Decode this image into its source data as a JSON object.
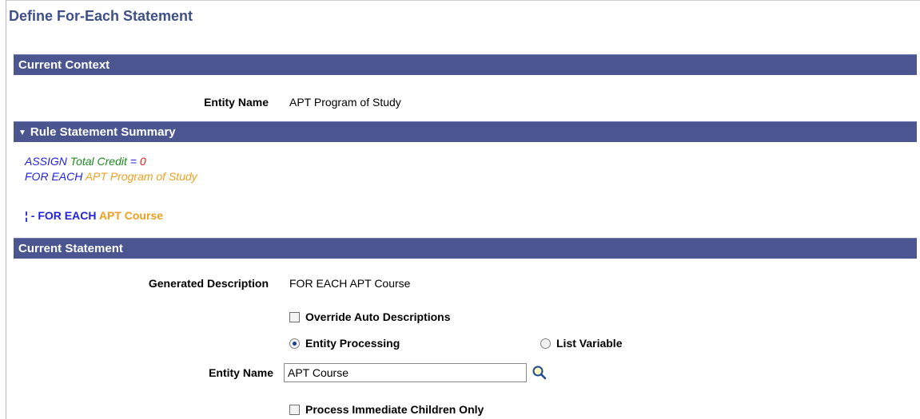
{
  "page": {
    "title": "Define For-Each Statement"
  },
  "current_context": {
    "header": "Current Context",
    "entity_label": "Entity Name",
    "entity_value": "APT Program of Study"
  },
  "summary": {
    "header": "Rule Statement Summary",
    "line1": {
      "keyword": "ASSIGN",
      "var": "Total Credit",
      "op": "=",
      "value": "0"
    },
    "line2": {
      "keyword": "FOR EACH",
      "entity": "APT Program of Study"
    },
    "line3": {
      "prefix": "¦ -",
      "keyword": "FOR EACH",
      "entity": "APT Course"
    }
  },
  "current_statement": {
    "header": "Current Statement",
    "generated_label": "Generated Description",
    "generated_value": "FOR EACH APT Course",
    "override_label": "Override Auto Descriptions",
    "override_checked": false,
    "radio_entity_label": "Entity Processing",
    "radio_list_label": "List Variable",
    "selected_radio": "Entity Processing",
    "entity_label": "Entity Name",
    "entity_value": "APT Course",
    "lookup_icon": "magnifier-icon",
    "children_label": "Process Immediate Children Only",
    "children_checked": false
  },
  "colors": {
    "header_bar": "#4b5691",
    "title": "#3e4f8a",
    "keyword": "#2222dd",
    "variable": "#1d8a1d",
    "literal": "#e01818",
    "entity": "#f0a020"
  }
}
